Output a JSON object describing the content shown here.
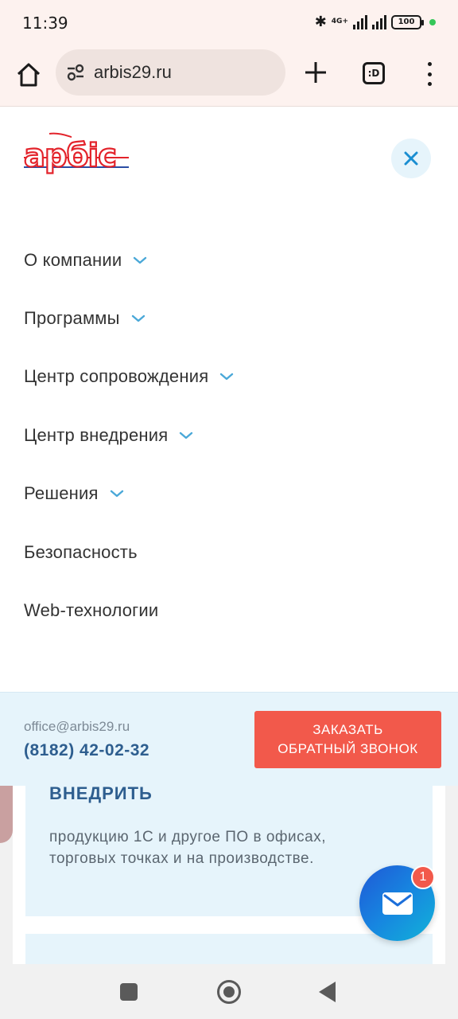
{
  "status_bar": {
    "time": "11:39",
    "network": "4G+",
    "battery": "100"
  },
  "browser": {
    "url": "arbis29.ru",
    "tabs_label": ":D"
  },
  "logo": {
    "text": "арбіс"
  },
  "nav": {
    "items": [
      {
        "label": "О компании",
        "has_submenu": true
      },
      {
        "label": "Программы",
        "has_submenu": true
      },
      {
        "label": "Центр сопровождения",
        "has_submenu": true
      },
      {
        "label": "Центр внедрения",
        "has_submenu": true
      },
      {
        "label": "Решения",
        "has_submenu": true
      },
      {
        "label": "Безопасность",
        "has_submenu": false
      },
      {
        "label": "Web-технологии",
        "has_submenu": false
      }
    ]
  },
  "contact": {
    "email": "office@arbis29.ru",
    "phone": "(8182) 42-02-32",
    "callback_line1": "ЗАКАЗАТЬ",
    "callback_line2": "ОБРАТНЫЙ ЗВОНОК"
  },
  "page": {
    "card_title": "ВНЕДРИТЬ",
    "card_text": "продукцию 1С и другое ПО в офисах, торговых точках и на производстве."
  },
  "chat": {
    "badge": "1"
  },
  "colors": {
    "accent_blue": "#2e5e8f",
    "chevron_blue": "#4aa8d8",
    "callback_red": "#f2594b",
    "panel_light_blue": "#e6f4fb",
    "logo_red": "#e3232b",
    "logo_blue": "#2b4da3"
  }
}
